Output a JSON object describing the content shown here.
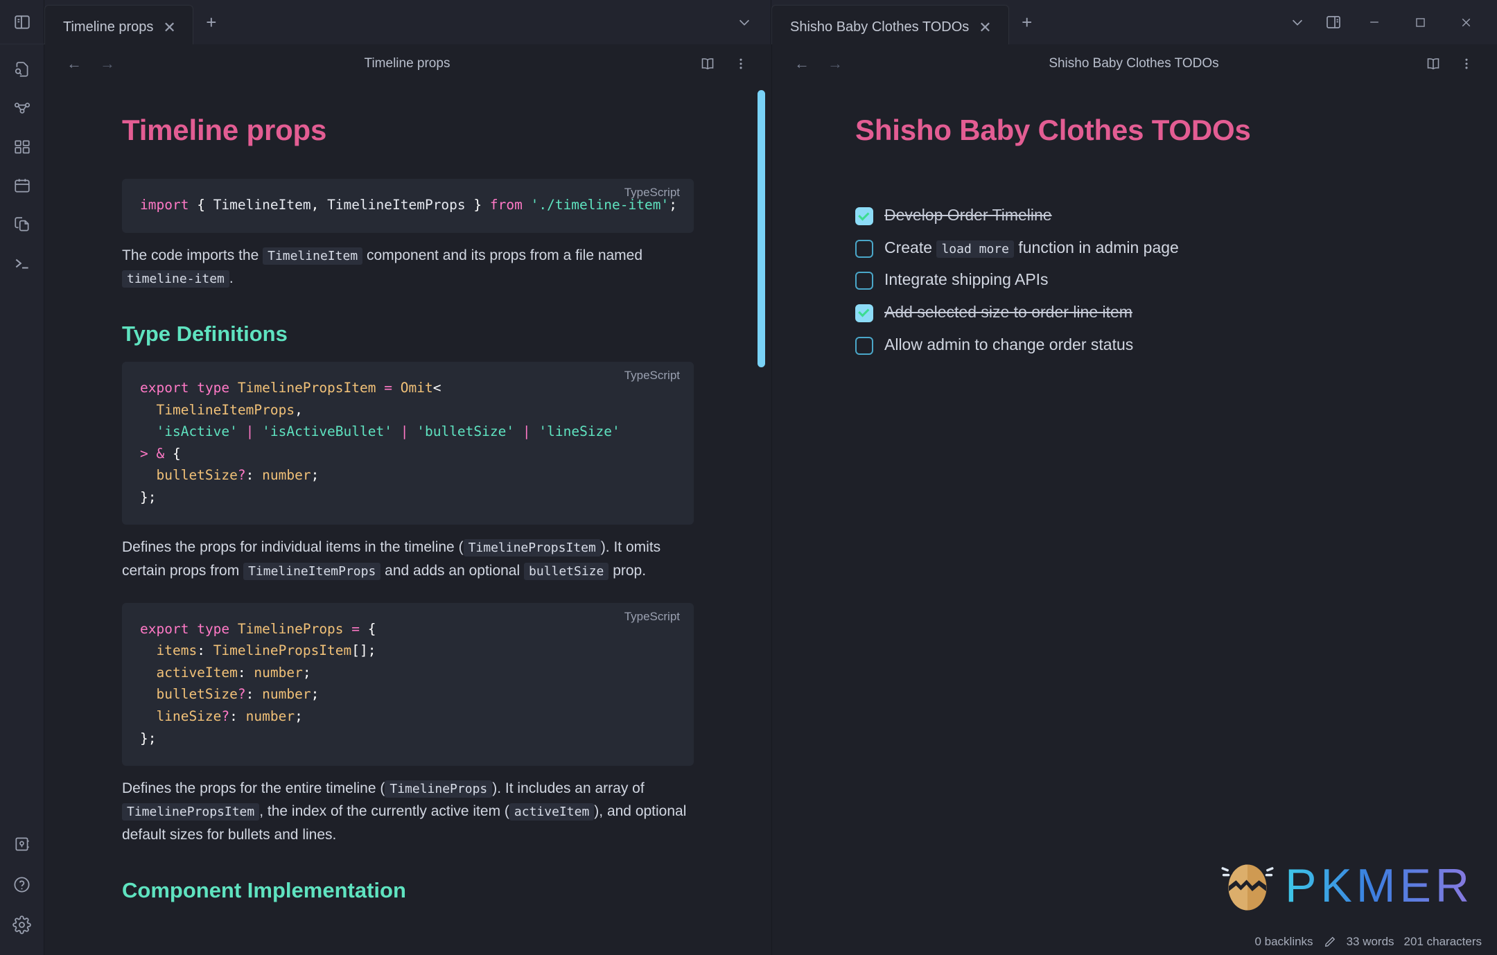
{
  "window": {
    "controls": [
      {
        "name": "chevron-down",
        "label": "∨"
      },
      {
        "name": "right-sidebar-toggle",
        "label": ""
      },
      {
        "name": "minimize",
        "label": "–"
      },
      {
        "name": "maximize",
        "label": "□"
      },
      {
        "name": "close",
        "label": "✕"
      }
    ]
  },
  "ribbon": {
    "toggle": {
      "name": "toggle-left-sidebar-icon",
      "title": "Toggle left sidebar"
    },
    "items": [
      {
        "name": "quick-switcher-icon",
        "title": "Quick switcher"
      },
      {
        "name": "graph-view-icon",
        "title": "Graph view"
      },
      {
        "name": "canvas-icon",
        "title": "Canvas"
      },
      {
        "name": "daily-note-icon",
        "title": "Daily note"
      },
      {
        "name": "templates-icon",
        "title": "Templates"
      },
      {
        "name": "terminal-icon",
        "title": "Terminal"
      }
    ],
    "bottom": [
      {
        "name": "vault-icon",
        "title": "Vault"
      },
      {
        "name": "help-icon",
        "title": "Help"
      },
      {
        "name": "settings-icon",
        "title": "Settings"
      }
    ]
  },
  "left_pane": {
    "tab": {
      "label": "Timeline props",
      "close": "✕"
    },
    "new_tab": "+",
    "tab_overflow": "∨",
    "nav_back": "←",
    "nav_forward": "→",
    "title": "Timeline props",
    "actions": [
      {
        "name": "reading-view-icon",
        "title": "Reading view"
      },
      {
        "name": "more-options-icon",
        "title": "More options"
      }
    ],
    "doc": {
      "h1": "Timeline props",
      "code1_lang": "TypeScript",
      "para1": {
        "a": "The code imports the ",
        "c1": "TimelineItem",
        "b": " component and its props from a file named ",
        "c2": "timeline-item",
        "d": "."
      },
      "h2_types": "Type Definitions",
      "code2_lang": "TypeScript",
      "para2": {
        "a": "Defines the props for individual items in the timeline (",
        "c1": "TimelinePropsItem",
        "b": "). It omits certain props from ",
        "c2": "TimelineItemProps",
        "c": " and adds an optional ",
        "c3": "bulletSize",
        "d": " prop."
      },
      "code3_lang": "TypeScript",
      "para3": {
        "a": "Defines the props for the entire timeline (",
        "c1": "TimelineProps",
        "b": "). It includes an array of ",
        "c2": "TimelinePropsItem",
        "c": ", the index of the currently active item (",
        "c3": "activeItem",
        "d": "), and optional default sizes for bullets and lines."
      },
      "h2_impl": "Component Implementation"
    }
  },
  "right_pane": {
    "tab": {
      "label": "Shisho Baby Clothes TODOs",
      "close": "✕"
    },
    "new_tab": "+",
    "nav_back": "←",
    "nav_forward": "→",
    "title": "Shisho Baby Clothes TODOs",
    "actions": [
      {
        "name": "reading-view-icon",
        "title": "Reading view"
      },
      {
        "name": "more-options-icon",
        "title": "More options"
      }
    ],
    "doc": {
      "h1": "Shisho Baby Clothes TODOs",
      "todos": [
        {
          "text": "Develop Order Timeline",
          "done": true
        },
        {
          "text_before": "Create ",
          "code": "load more",
          "text_after": " function in admin page",
          "done": false
        },
        {
          "text": "Integrate shipping APIs",
          "done": false
        },
        {
          "text": "Add selected size to order line item",
          "done": true
        },
        {
          "text": "Allow admin to change order status",
          "done": false
        }
      ]
    }
  },
  "watermark": {
    "text": "PKMER"
  },
  "statusbar": {
    "backlinks": "0 backlinks",
    "edit_icon": "pencil-icon",
    "words": "33 words",
    "characters": "201 characters"
  },
  "colors": {
    "background": "#1e2028",
    "chrome": "#22242e",
    "heading_pink": "#e35d93",
    "heading_teal": "#5fe3c0",
    "code_bg": "#262a34",
    "accent_cyan": "#8ddcf7",
    "scrollbar": "#79d2f7",
    "keyword_pink": "#ff79c6",
    "type_orange": "#f1c178",
    "string_mint": "#5fe3c0"
  }
}
